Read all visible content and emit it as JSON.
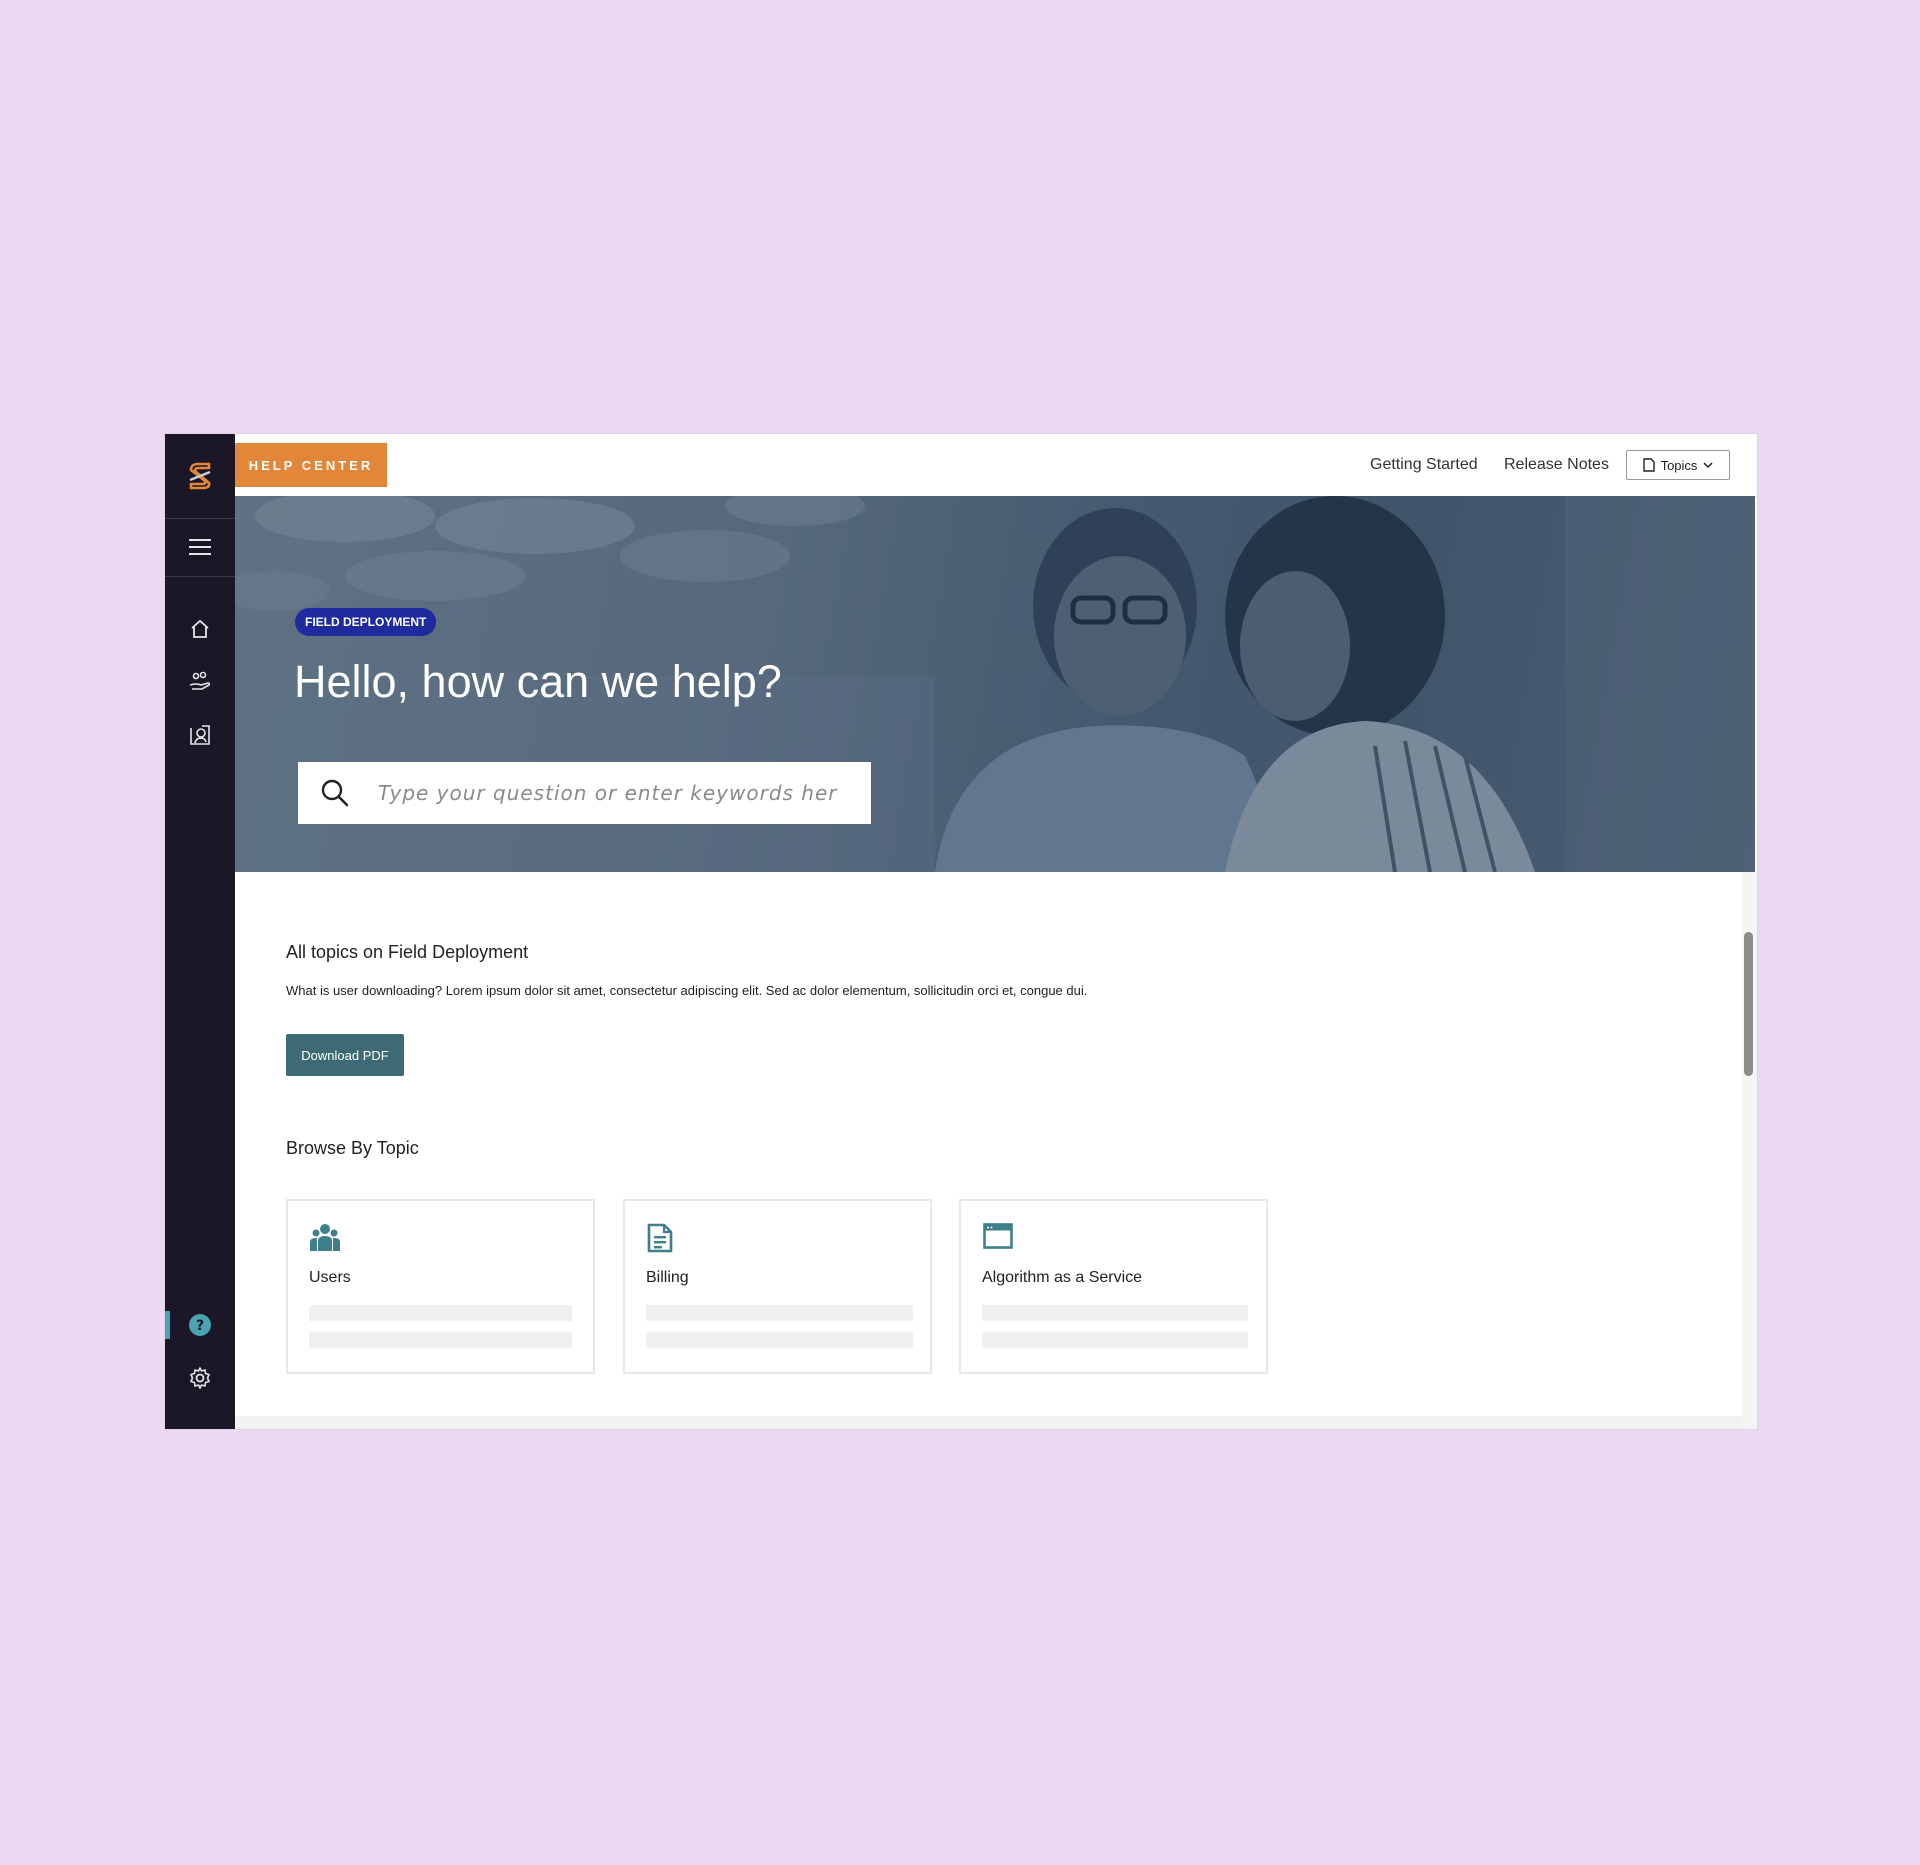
{
  "topbar": {
    "badge": "HELP CENTER",
    "links": [
      "Getting Started",
      "Release Notes"
    ],
    "topics_label": "Topics"
  },
  "sidebar": {
    "icons": [
      "logo-icon",
      "menu-icon",
      "home-icon",
      "users-hand-icon",
      "profile-icon",
      "help-icon",
      "gear-icon"
    ],
    "active_color": "#4aa3b0"
  },
  "hero": {
    "tag": "FIELD DEPLOYMENT",
    "title": "Hello, how can we help?",
    "search_placeholder": "Type your question or enter keywords here"
  },
  "main": {
    "section_title": "All topics on Field Deployment",
    "description": "What is user downloading? Lorem ipsum dolor sit amet, consectetur adipiscing elit. Sed ac dolor elementum, sollicitudin orci et, congue dui.",
    "download_label": "Download PDF",
    "browse_title": "Browse By Topic",
    "cards": [
      {
        "title": "Users",
        "icon": "users-icon"
      },
      {
        "title": "Billing",
        "icon": "document-icon"
      },
      {
        "title": "Algorithm as a Service",
        "icon": "browser-window-icon"
      }
    ]
  },
  "colors": {
    "accent_orange": "#e2873a",
    "tag_blue": "#1f2a9e",
    "teal_button": "#3e6a76",
    "icon_teal": "#3f7f8b",
    "sidebar_bg": "#1b1726",
    "page_bg": "#ead9f1"
  }
}
